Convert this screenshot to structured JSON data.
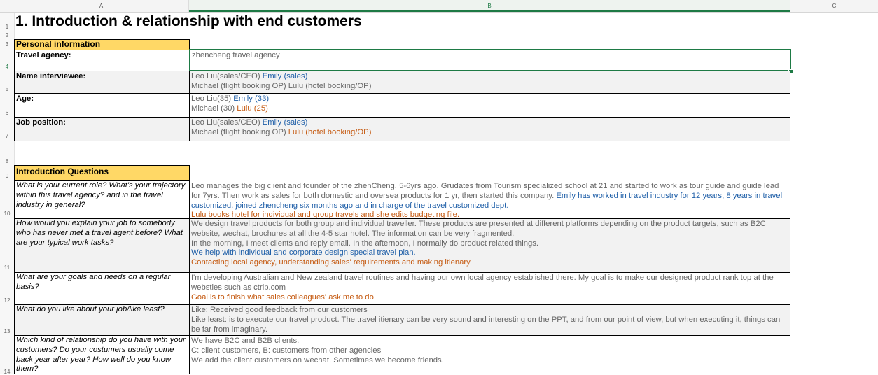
{
  "columns": [
    "A",
    "B",
    "C"
  ],
  "rows": [
    "1",
    "2",
    "3",
    "4",
    "5",
    "6",
    "7",
    "8",
    "9",
    "10",
    "11",
    "12",
    "13",
    "14"
  ],
  "title": "1. Introduction & relationship with end customers",
  "personal": {
    "header": "Personal information",
    "rows": [
      {
        "label": "Travel agency:",
        "lines": [
          [
            {
              "t": "zhencheng travel agency",
              "c": "gray"
            }
          ]
        ]
      },
      {
        "label": "Name interviewee:",
        "lines": [
          [
            {
              "t": "Leo Liu(sales/CEO)  ",
              "c": "gray"
            },
            {
              "t": "Emily (sales)",
              "c": "blue"
            }
          ],
          [
            {
              "t": "Michael (flight booking OP) Lulu (hotel booking/OP)",
              "c": "gray"
            }
          ]
        ]
      },
      {
        "label": "Age:",
        "lines": [
          [
            {
              "t": "Leo Liu(35)  ",
              "c": "gray"
            },
            {
              "t": "Emily (33)",
              "c": "blue"
            }
          ],
          [
            {
              "t": "Michael (30) ",
              "c": "gray"
            },
            {
              "t": "Lulu (25)",
              "c": "orange"
            }
          ]
        ]
      },
      {
        "label": "Job position:",
        "lines": [
          [
            {
              "t": "Leo Liu(sales/CEO)  ",
              "c": "gray"
            },
            {
              "t": "Emily (sales)",
              "c": "blue"
            }
          ],
          [
            {
              "t": "Michael (flight booking OP) ",
              "c": "gray"
            },
            {
              "t": "Lulu (hotel booking/OP)",
              "c": "orange"
            }
          ]
        ]
      }
    ]
  },
  "intro": {
    "header": "Introduction Questions",
    "rows": [
      {
        "q": "What is your current role? What's your trajectory within this travel agency? and in the travel industry in general?",
        "lines": [
          [
            {
              "t": "Leo manages the big client and founder of the zhenCheng. 5-6yrs ago. Grudates from Tourism specialized school at 21 and started to work as tour guide and guide lead for 7yrs. Then work as sales for both domestic and oversea products for 1 yr, then started this company. ",
              "c": "gray"
            },
            {
              "t": "Emily has worked in travel industry for 12 years, 8 years in travel customized, joined zhencheng six months ago and in charge of the travel customized dept.",
              "c": "blue"
            }
          ],
          [
            {
              "t": "Lulu books hotel for individual and group travels and she edits budgeting file.",
              "c": "orange"
            }
          ]
        ]
      },
      {
        "q": "How would you explain your job to somebody who has never met a travel agent before? What are your typical work tasks?",
        "lines": [
          [
            {
              "t": "We design travel products for both group and individual traveller. These products are presented at different platforms depending on the product targets, such as B2C website, wechat, brochures at all the 4-5 star hotel. The information can be very fragmented.",
              "c": "gray"
            }
          ],
          [
            {
              "t": "In the morning, I meet clients and reply email. In the afternoon, I normally do product related things.",
              "c": "gray"
            }
          ],
          [
            {
              "t": "We help with individual and corporate design special travel plan.",
              "c": "blue"
            }
          ],
          [
            {
              "t": "Contacting local agency, understanding sales' requirements and making itienary",
              "c": "orange"
            }
          ]
        ]
      },
      {
        "q": "What are your goals and needs on a regular basis?",
        "lines": [
          [
            {
              "t": "I'm developing Australian and New zealand travel routines and having our own local agency established there. My goal is to make our designed product rank top at the websties such as ctrip.com",
              "c": "gray"
            }
          ],
          [
            {
              "t": "Goal is to finish what sales colleagues' ask me to do",
              "c": "orange"
            }
          ]
        ]
      },
      {
        "q": "What do you like about your job/like least?",
        "lines": [
          [
            {
              "t": "Like: Received good feedback from our customers",
              "c": "gray"
            }
          ],
          [
            {
              "t": "Like least: is to execute our travel product. The travel itienary can be very sound and interesting on the PPT, and from our point of view, but when executing it, things can be far from imaginary.",
              "c": "gray"
            }
          ]
        ]
      },
      {
        "q": "Which kind of relationship do you have with your customers? Do your costumers usually come back year after year? How well do you know them?",
        "lines": [
          [
            {
              "t": "We have B2C and B2B clients.",
              "c": "gray"
            }
          ],
          [
            {
              "t": "C: client customers, B: customers from other agencies",
              "c": "gray"
            }
          ],
          [
            {
              "t": "We add the client customers on wechat. Sometimes we become friends.",
              "c": "gray"
            }
          ]
        ]
      }
    ]
  }
}
